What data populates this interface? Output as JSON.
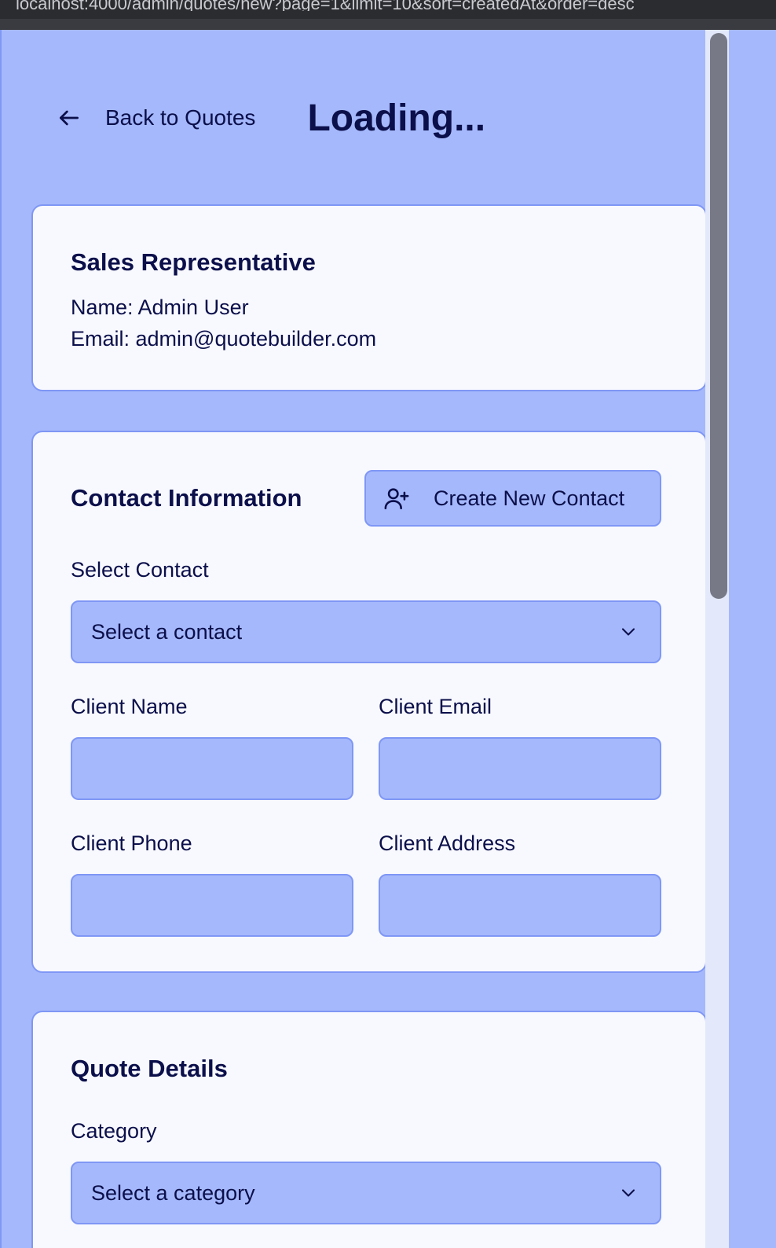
{
  "browser": {
    "url_bar_text": "localhost:4000/admin/quotes/new?page=1&limit=10&sort=createdAt&order=desc"
  },
  "header": {
    "back_label": "Back to Quotes",
    "title": "Loading..."
  },
  "sales_rep": {
    "title": "Sales Representative",
    "name_line": "Name: Admin User",
    "email_line": "Email: admin@quotebuilder.com"
  },
  "contact": {
    "title": "Contact Information",
    "create_button_label": "Create New Contact",
    "select_label": "Select Contact",
    "select_value": "Select a contact",
    "client_name_label": "Client Name",
    "client_name_value": "",
    "client_email_label": "Client Email",
    "client_email_value": "",
    "client_phone_label": "Client Phone",
    "client_phone_value": "",
    "client_address_label": "Client Address",
    "client_address_value": ""
  },
  "quote_details": {
    "title": "Quote Details",
    "category_label": "Category",
    "category_value": "Select a category"
  },
  "colors": {
    "background": "#a5b8fb",
    "card": "#f8f9ff",
    "border": "#7f97f5",
    "text": "#0b0f4a"
  }
}
